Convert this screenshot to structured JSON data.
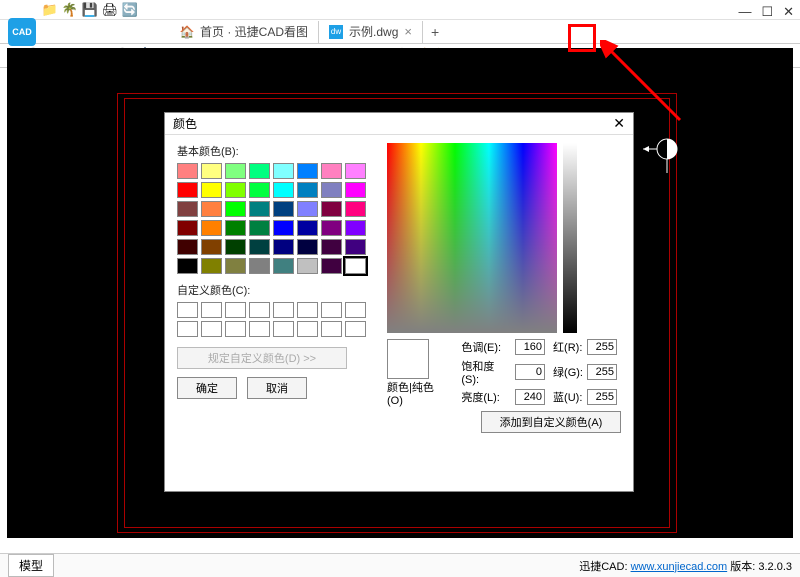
{
  "tabs": {
    "home": {
      "label": "首页 · 迅捷CAD看图"
    },
    "file": {
      "label": "示例.dwg"
    }
  },
  "dialog": {
    "title": "颜色",
    "basic_label": "基本颜色(B):",
    "custom_label": "自定义颜色(C):",
    "define_label": "规定自定义颜色(D) >>",
    "ok_label": "确定",
    "cancel_label": "取消",
    "preview_label": "颜色|纯色(O)",
    "hue_label": "色调(E):",
    "sat_label": "饱和度(S):",
    "lum_label": "亮度(L):",
    "red_label": "红(R):",
    "green_label": "绿(G):",
    "blue_label": "蓝(U):",
    "hue_val": "160",
    "sat_val": "0",
    "lum_val": "240",
    "red_val": "255",
    "green_val": "255",
    "blue_val": "255",
    "add_label": "添加到自定义颜色(A)"
  },
  "basic_colors": [
    "#ff8080",
    "#ffff80",
    "#80ff80",
    "#00ff80",
    "#80ffff",
    "#0080ff",
    "#ff80c0",
    "#ff80ff",
    "#ff0000",
    "#ffff00",
    "#80ff00",
    "#00ff40",
    "#00ffff",
    "#0080c0",
    "#8080c0",
    "#ff00ff",
    "#804040",
    "#ff8040",
    "#00ff00",
    "#008080",
    "#004080",
    "#8080ff",
    "#800040",
    "#ff0080",
    "#800000",
    "#ff8000",
    "#008000",
    "#008040",
    "#0000ff",
    "#0000a0",
    "#800080",
    "#8000ff",
    "#400000",
    "#804000",
    "#004000",
    "#004040",
    "#000080",
    "#000040",
    "#400040",
    "#400080",
    "#000000",
    "#808000",
    "#808040",
    "#808080",
    "#408080",
    "#c0c0c0",
    "#400040",
    "#ffffff"
  ],
  "status": {
    "model_tab": "模型",
    "brand": "迅捷CAD:",
    "link": "www.xunjiecad.com",
    "version_label": "版本:",
    "version": "3.2.0.3"
  },
  "logo": "CAD"
}
